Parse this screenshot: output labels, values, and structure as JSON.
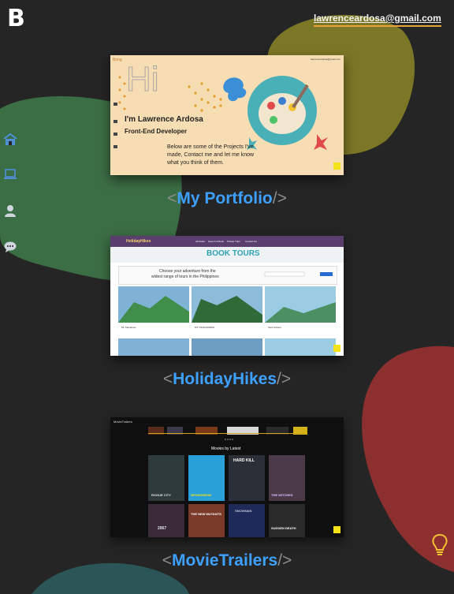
{
  "header": {
    "logo": "B",
    "email": "lawrenceardosa@gmail.com"
  },
  "side_nav": [
    {
      "icon": "home-icon"
    },
    {
      "icon": "laptop-icon"
    },
    {
      "icon": "user-icon"
    },
    {
      "icon": "chat-icon"
    }
  ],
  "projects": [
    {
      "name": "My Portfolio",
      "preview": {
        "brand": "Bong",
        "email": "lawrenceardosa@gmail.com",
        "hi": "Hi",
        "greeting": "I'm Lawrence Ardosa",
        "role": "Front-End Developer",
        "intro_1": "Below are some of the Projects I've",
        "intro_2": "made, Contact me and let me know",
        "intro_3": "what you think of them."
      }
    },
    {
      "name": "HolidayHikes",
      "preview": {
        "brand": "HolidayHikes",
        "nav": [
          "All Deals",
          "Search & Book",
          "Private Trips",
          "Contact Us"
        ],
        "banner": "BOOK TOURS",
        "tagline_1": "Choose your adventure from the",
        "tagline_2": "widest range of tours in the Philippines",
        "tours": [
          "Mt. Manalmon",
          "MT. PINAGSUBAN",
          "Taal Volcano"
        ]
      }
    },
    {
      "name": "MovieTrailers",
      "preview": {
        "brand": "MovieTrailers",
        "section": "Movies by Latest",
        "posters": [
          "ROGUE CITY",
          "SPONGEBOB",
          "HARD KILL",
          "THE WITCHES",
          "2067",
          "THE NEW MUTANTS",
          "SNOWMAN",
          "SUDDEN DEATH"
        ]
      }
    }
  ],
  "colors": {
    "background": "#252525",
    "accent": "#3ea0ff",
    "blob_green": "#3c6e45",
    "blob_olive": "#7c7726",
    "blob_red": "#8c2f2f",
    "blob_teal": "#2b5557",
    "email_underline": "#e8a23a"
  }
}
